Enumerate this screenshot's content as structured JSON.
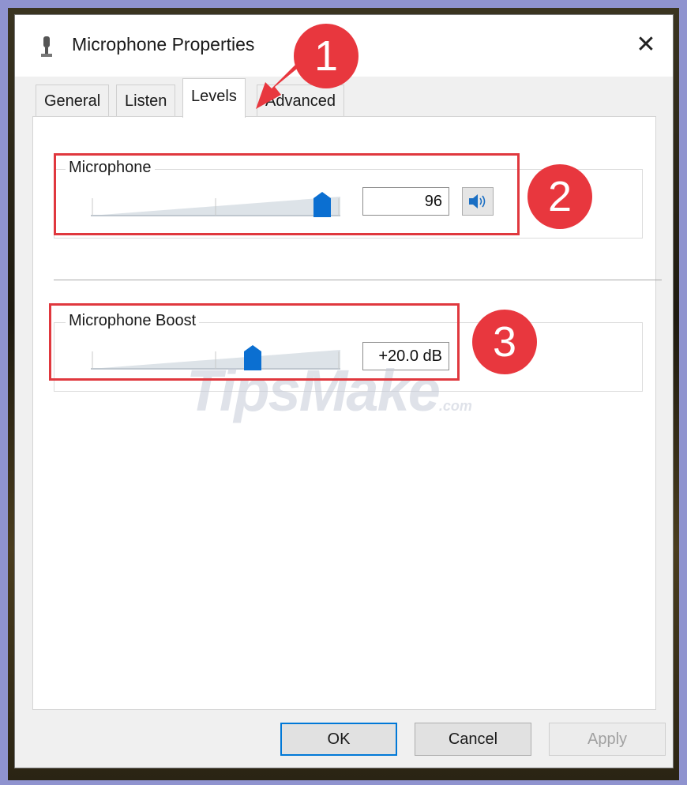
{
  "window": {
    "title": "Microphone Properties",
    "close_glyph": "✕"
  },
  "tabs": [
    {
      "label": "General",
      "active": false
    },
    {
      "label": "Listen",
      "active": false
    },
    {
      "label": "Levels",
      "active": true
    },
    {
      "label": "Advanced",
      "active": false
    }
  ],
  "levels": {
    "microphone": {
      "label": "Microphone",
      "value": "96",
      "slider_fraction": 0.96,
      "mute_icon": "speaker-icon"
    },
    "boost": {
      "label": "Microphone Boost",
      "value": "+20.0 dB",
      "slider_fraction": 0.66
    }
  },
  "buttons": {
    "ok": "OK",
    "cancel": "Cancel",
    "apply": "Apply"
  },
  "watermark": {
    "main": "TipsMake",
    "suffix": ".com"
  },
  "annotations": {
    "badge_1": "1",
    "badge_2": "2",
    "badge_3": "3"
  },
  "colors": {
    "accent": "#0078d7",
    "annotation": "#e0383e"
  }
}
